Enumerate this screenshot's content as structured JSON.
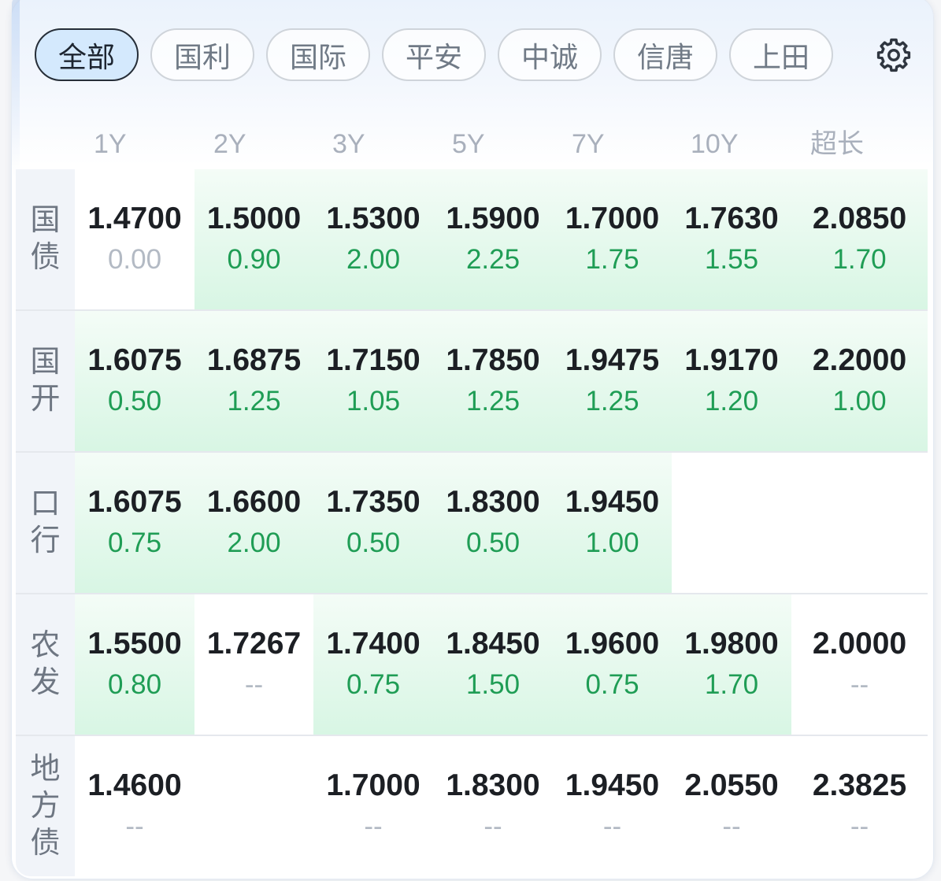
{
  "tabs": [
    {
      "label": "全部",
      "selected": true
    },
    {
      "label": "国利",
      "selected": false
    },
    {
      "label": "国际",
      "selected": false
    },
    {
      "label": "平安",
      "selected": false
    },
    {
      "label": "中诚",
      "selected": false
    },
    {
      "label": "信唐",
      "selected": false
    },
    {
      "label": "上田",
      "selected": false
    }
  ],
  "toolbar": {
    "settings_icon": "gear-icon"
  },
  "columns": [
    "1Y",
    "2Y",
    "3Y",
    "5Y",
    "7Y",
    "10Y",
    "超长"
  ],
  "rows": [
    {
      "label": "国债",
      "cells": [
        {
          "yield": "1.4700",
          "change": "0.00",
          "highlight": false
        },
        {
          "yield": "1.5000",
          "change": "0.90",
          "highlight": true
        },
        {
          "yield": "1.5300",
          "change": "2.00",
          "highlight": true
        },
        {
          "yield": "1.5900",
          "change": "2.25",
          "highlight": true
        },
        {
          "yield": "1.7000",
          "change": "1.75",
          "highlight": true
        },
        {
          "yield": "1.7630",
          "change": "1.55",
          "highlight": true
        },
        {
          "yield": "2.0850",
          "change": "1.70",
          "highlight": true
        }
      ]
    },
    {
      "label": "国开",
      "cells": [
        {
          "yield": "1.6075",
          "change": "0.50",
          "highlight": true
        },
        {
          "yield": "1.6875",
          "change": "1.25",
          "highlight": true
        },
        {
          "yield": "1.7150",
          "change": "1.05",
          "highlight": true
        },
        {
          "yield": "1.7850",
          "change": "1.25",
          "highlight": true
        },
        {
          "yield": "1.9475",
          "change": "1.25",
          "highlight": true
        },
        {
          "yield": "1.9170",
          "change": "1.20",
          "highlight": true
        },
        {
          "yield": "2.2000",
          "change": "1.00",
          "highlight": true
        }
      ]
    },
    {
      "label": "口行",
      "cells": [
        {
          "yield": "1.6075",
          "change": "0.75",
          "highlight": true
        },
        {
          "yield": "1.6600",
          "change": "2.00",
          "highlight": true
        },
        {
          "yield": "1.7350",
          "change": "0.50",
          "highlight": true
        },
        {
          "yield": "1.8300",
          "change": "0.50",
          "highlight": true
        },
        {
          "yield": "1.9450",
          "change": "1.00",
          "highlight": true
        },
        null,
        null
      ]
    },
    {
      "label": "农发",
      "cells": [
        {
          "yield": "1.5500",
          "change": "0.80",
          "highlight": true
        },
        {
          "yield": "1.7267",
          "change": "--",
          "highlight": false
        },
        {
          "yield": "1.7400",
          "change": "0.75",
          "highlight": true
        },
        {
          "yield": "1.8450",
          "change": "1.50",
          "highlight": true
        },
        {
          "yield": "1.9600",
          "change": "0.75",
          "highlight": true
        },
        {
          "yield": "1.9800",
          "change": "1.70",
          "highlight": true
        },
        {
          "yield": "2.0000",
          "change": "--",
          "highlight": false
        }
      ]
    },
    {
      "label": "地方债",
      "cells": [
        {
          "yield": "1.4600",
          "change": "--",
          "highlight": false
        },
        null,
        {
          "yield": "1.7000",
          "change": "--",
          "highlight": false
        },
        {
          "yield": "1.8300",
          "change": "--",
          "highlight": false
        },
        {
          "yield": "1.9450",
          "change": "--",
          "highlight": false
        },
        {
          "yield": "2.0550",
          "change": "--",
          "highlight": false
        },
        {
          "yield": "2.3825",
          "change": "--",
          "highlight": false
        }
      ]
    }
  ],
  "colors": {
    "positive": "#1f9d55",
    "muted": "#b3bac4",
    "highlight_top": "#f4fcf7",
    "highlight_bottom": "#d8f6e4",
    "selected_tab": "#d4e9fd"
  }
}
